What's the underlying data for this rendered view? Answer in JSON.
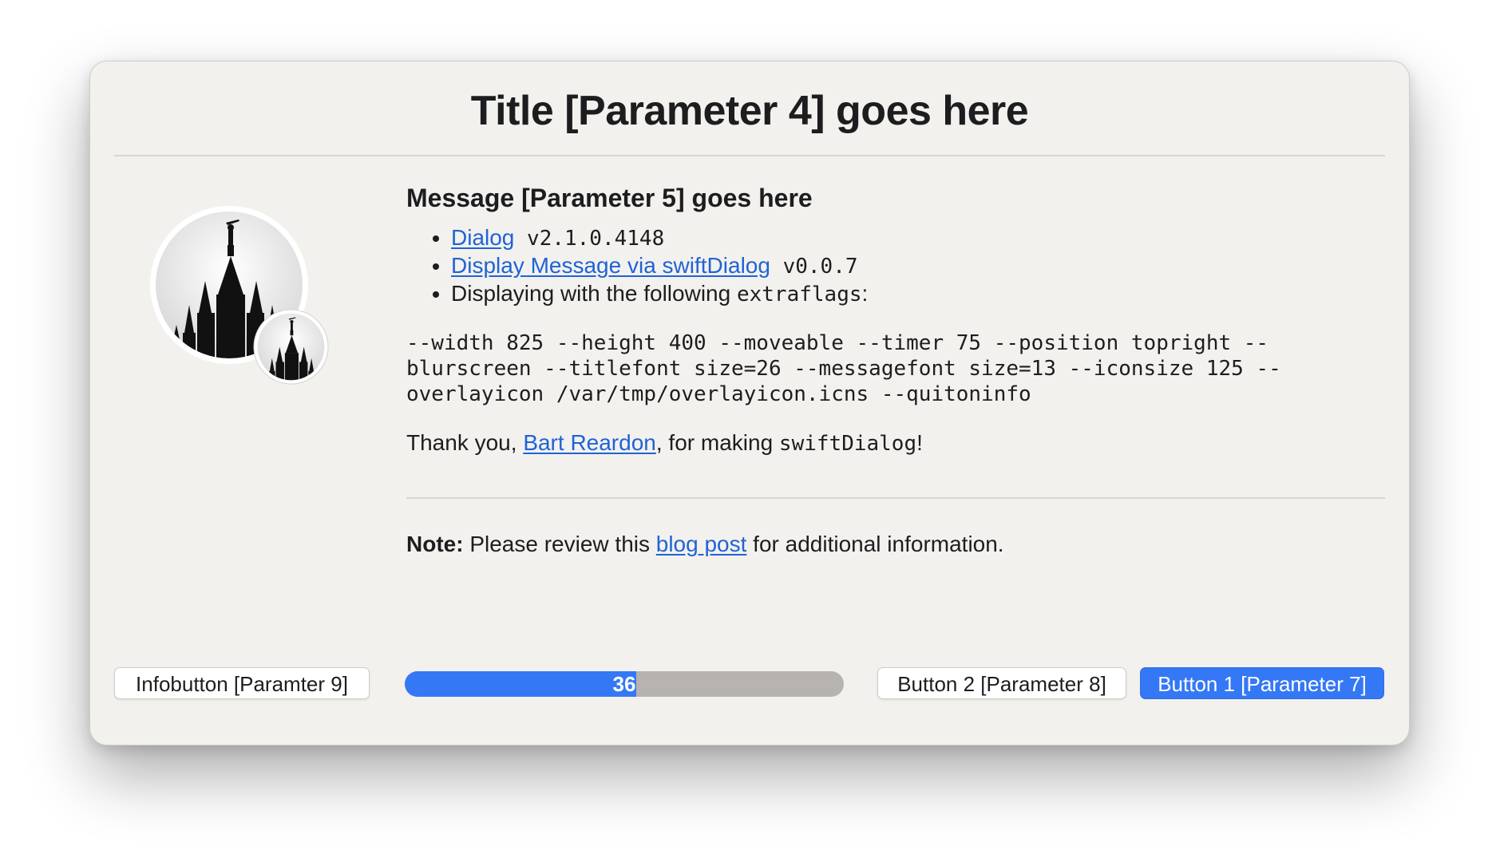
{
  "dialog": {
    "title": "Title [Parameter 4] goes here",
    "message": {
      "heading": "Message [Parameter 5] goes here",
      "bullets": [
        {
          "link": "Dialog",
          "suffix": " v2.1.0.4148"
        },
        {
          "link": "Display Message via swiftDialog",
          "suffix": " v0.0.7"
        },
        {
          "text": "Displaying with the following ",
          "mono": "extraflags",
          "suffix": ":"
        }
      ],
      "code": "--width 825 --height 400 --moveable --timer 75 --position topright --blurscreen --titlefont size=26 --messagefont size=13 --iconsize 125 --overlayicon /var/tmp/overlayicon.icns --quitoninfo",
      "thanks": {
        "prefix": "Thank you, ",
        "link": "Bart Reardon",
        "middle": ", for making ",
        "mono": "swiftDialog",
        "suffix": "!"
      },
      "note": {
        "label": "Note:",
        "prefix": " Please review this ",
        "link": "blog post",
        "suffix": " for additional information."
      }
    },
    "buttons": {
      "info": "Infobutton [Paramter 9]",
      "button2": "Button 2 [Parameter 8]",
      "button1": "Button 1 [Parameter 7]"
    },
    "progress": {
      "label": "36",
      "fraction": 0.527
    },
    "colors": {
      "accent": "#3478f6",
      "link": "#1f63d6",
      "window_bg": "#f3f1ee",
      "progress_track": "#b6b3b0"
    },
    "icons": {
      "main": "temple-silhouette-icon",
      "overlay": "temple-silhouette-overlay-icon"
    }
  }
}
